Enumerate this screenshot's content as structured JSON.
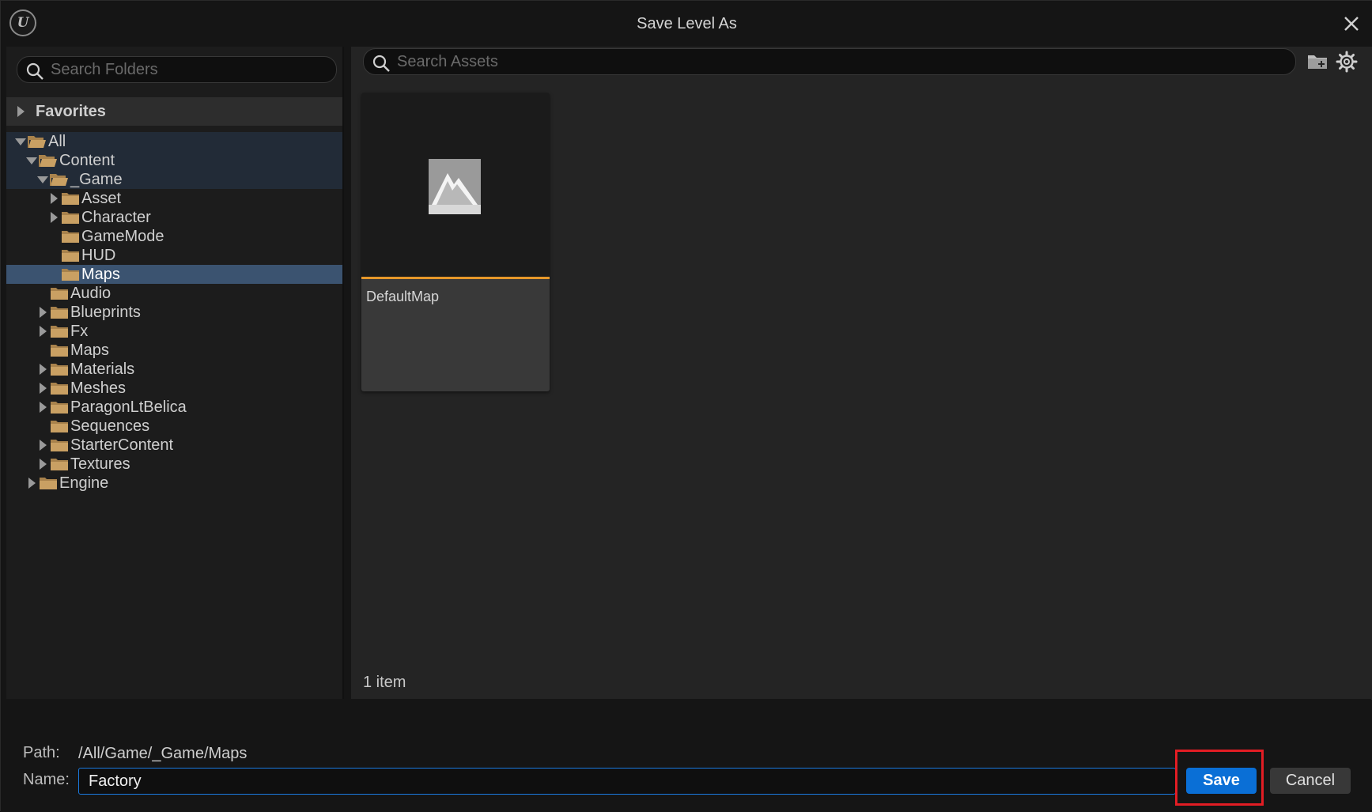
{
  "window": {
    "title": "Save Level As"
  },
  "folders_panel": {
    "search_placeholder": "Search Folders",
    "favorites_label": "Favorites",
    "tree": [
      {
        "label": "All",
        "level": 0,
        "arrow": "down",
        "state": "highlighted"
      },
      {
        "label": "Content",
        "level": 1,
        "arrow": "down",
        "state": "highlighted"
      },
      {
        "label": "_Game",
        "level": 2,
        "arrow": "down",
        "state": "highlighted"
      },
      {
        "label": "Asset",
        "level": 3,
        "arrow": "right",
        "state": ""
      },
      {
        "label": "Character",
        "level": 3,
        "arrow": "right",
        "state": ""
      },
      {
        "label": "GameMode",
        "level": 3,
        "arrow": "none",
        "state": ""
      },
      {
        "label": "HUD",
        "level": 3,
        "arrow": "none",
        "state": ""
      },
      {
        "label": "Maps",
        "level": 3,
        "arrow": "none",
        "state": "selected"
      },
      {
        "label": "Audio",
        "level": 2,
        "arrow": "none",
        "state": ""
      },
      {
        "label": "Blueprints",
        "level": 2,
        "arrow": "right",
        "state": ""
      },
      {
        "label": "Fx",
        "level": 2,
        "arrow": "right",
        "state": ""
      },
      {
        "label": "Maps",
        "level": 2,
        "arrow": "none",
        "state": ""
      },
      {
        "label": "Materials",
        "level": 2,
        "arrow": "right",
        "state": ""
      },
      {
        "label": "Meshes",
        "level": 2,
        "arrow": "right",
        "state": ""
      },
      {
        "label": "ParagonLtBelica",
        "level": 2,
        "arrow": "right",
        "state": ""
      },
      {
        "label": "Sequences",
        "level": 2,
        "arrow": "none",
        "state": ""
      },
      {
        "label": "StarterContent",
        "level": 2,
        "arrow": "right",
        "state": ""
      },
      {
        "label": "Textures",
        "level": 2,
        "arrow": "right",
        "state": ""
      },
      {
        "label": "Engine",
        "level": 1,
        "arrow": "right",
        "state": ""
      }
    ]
  },
  "assets_panel": {
    "search_placeholder": "Search Assets",
    "assets": [
      {
        "name": "DefaultMap",
        "type": "Level"
      }
    ],
    "item_count": "1 item"
  },
  "footer": {
    "path_label": "Path:",
    "path_value": "/All/Game/_Game/Maps",
    "name_label": "Name:",
    "name_value": "Factory",
    "save_label": "Save",
    "cancel_label": "Cancel"
  },
  "colors": {
    "folder": "#c9a063",
    "folder_dark": "#a8824c",
    "accent_blue": "#0a6fd6",
    "selected_row": "#3b5370",
    "level_bar": "#e7982a",
    "annotation_red": "#e21d24"
  },
  "icons": {
    "logo": "unreal-logo-icon",
    "close": "close-icon",
    "search": "search-icon",
    "add_folder": "add-folder-icon",
    "settings": "gear-icon",
    "level": "level-icon"
  }
}
